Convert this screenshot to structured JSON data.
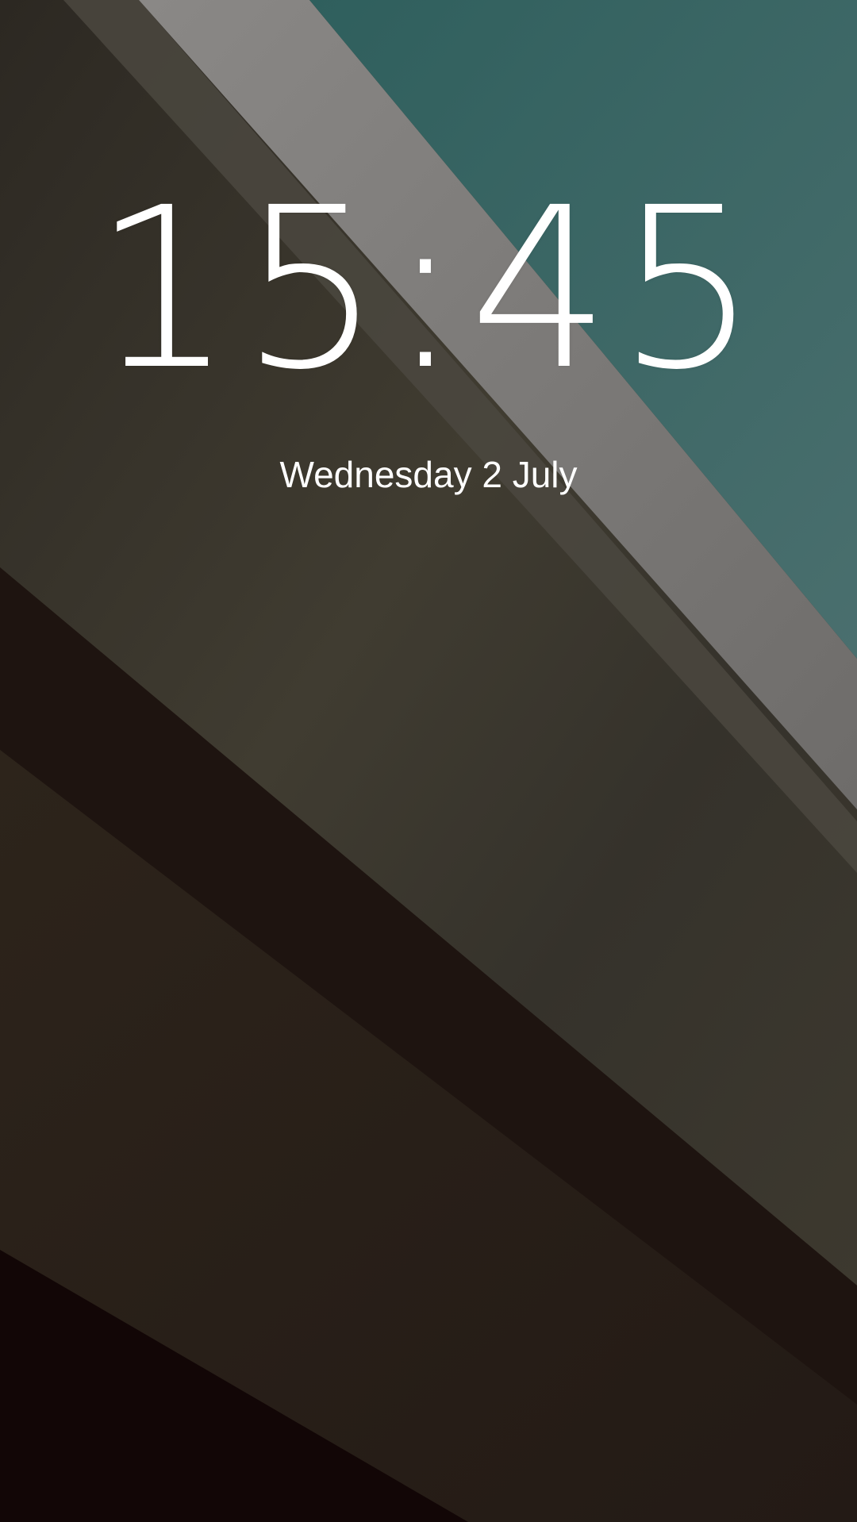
{
  "lockscreen": {
    "time": "15:45",
    "date": "Wednesday 2 July"
  },
  "wallpaper": {
    "colors": {
      "teal": "#3f6766",
      "light_gray_band": "#7a7876",
      "olive_band": "#3e3a30",
      "dark_brown_band": "#1f1510",
      "brown_band": "#2a1f18",
      "bottom_dark": "#130707"
    }
  }
}
